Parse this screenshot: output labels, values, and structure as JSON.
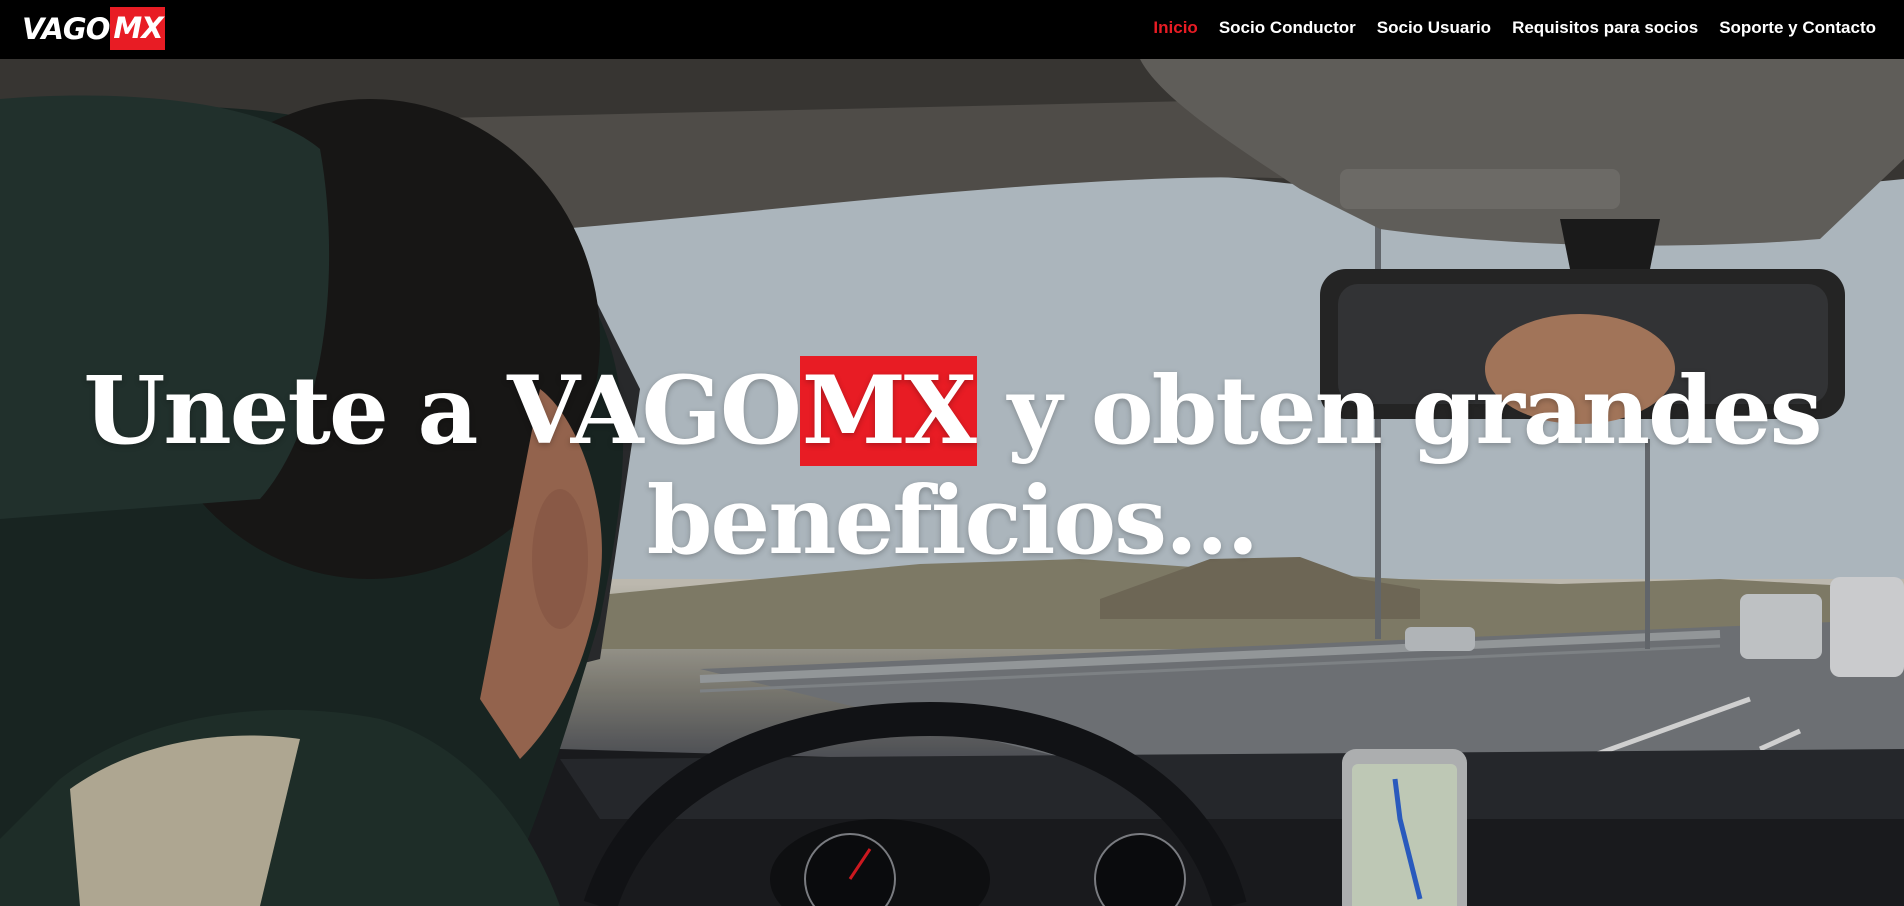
{
  "brand": {
    "logo_part1": "VAGO",
    "logo_part2": "MX",
    "accent_color": "#e81c24"
  },
  "nav": {
    "items": [
      {
        "label": "Inicio",
        "active": true
      },
      {
        "label": "Socio Conductor",
        "active": false
      },
      {
        "label": "Socio Usuario",
        "active": false
      },
      {
        "label": "Requisitos para socios",
        "active": false
      },
      {
        "label": "Soporte y Contacto",
        "active": false
      }
    ]
  },
  "hero": {
    "title_before": "Unete a VAGO",
    "title_highlight": "MX",
    "title_after": " y obten grandes beneficios...",
    "background_description_icon": "car-interior-driver-photo"
  }
}
